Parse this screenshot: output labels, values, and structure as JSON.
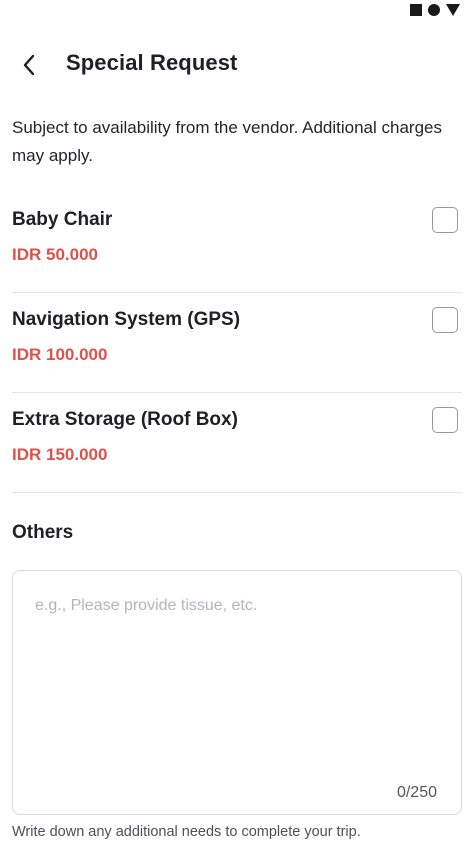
{
  "header": {
    "title": "Special Request",
    "back_icon": "chevron-left-icon"
  },
  "status_bar": {
    "icons": [
      "square-icon",
      "circle-icon",
      "triangle-icon"
    ]
  },
  "subtitle": "Subject to availability from the vendor. Additional charges may apply.",
  "options": [
    {
      "name": "Baby Chair",
      "price": "IDR 50.000",
      "checked": false
    },
    {
      "name": "Navigation System (GPS)",
      "price": "IDR 100.000",
      "checked": false
    },
    {
      "name": "Extra Storage (Roof Box)",
      "price": "IDR 150.000",
      "checked": false
    }
  ],
  "others": {
    "label": "Others",
    "placeholder": "e.g., Please provide tissue, etc.",
    "counter": "0/250",
    "helper": "Write down any additional needs to complete your trip."
  },
  "colors": {
    "price": "#e0514a",
    "text": "#1f1f24",
    "divider": "#e4e4e8"
  }
}
